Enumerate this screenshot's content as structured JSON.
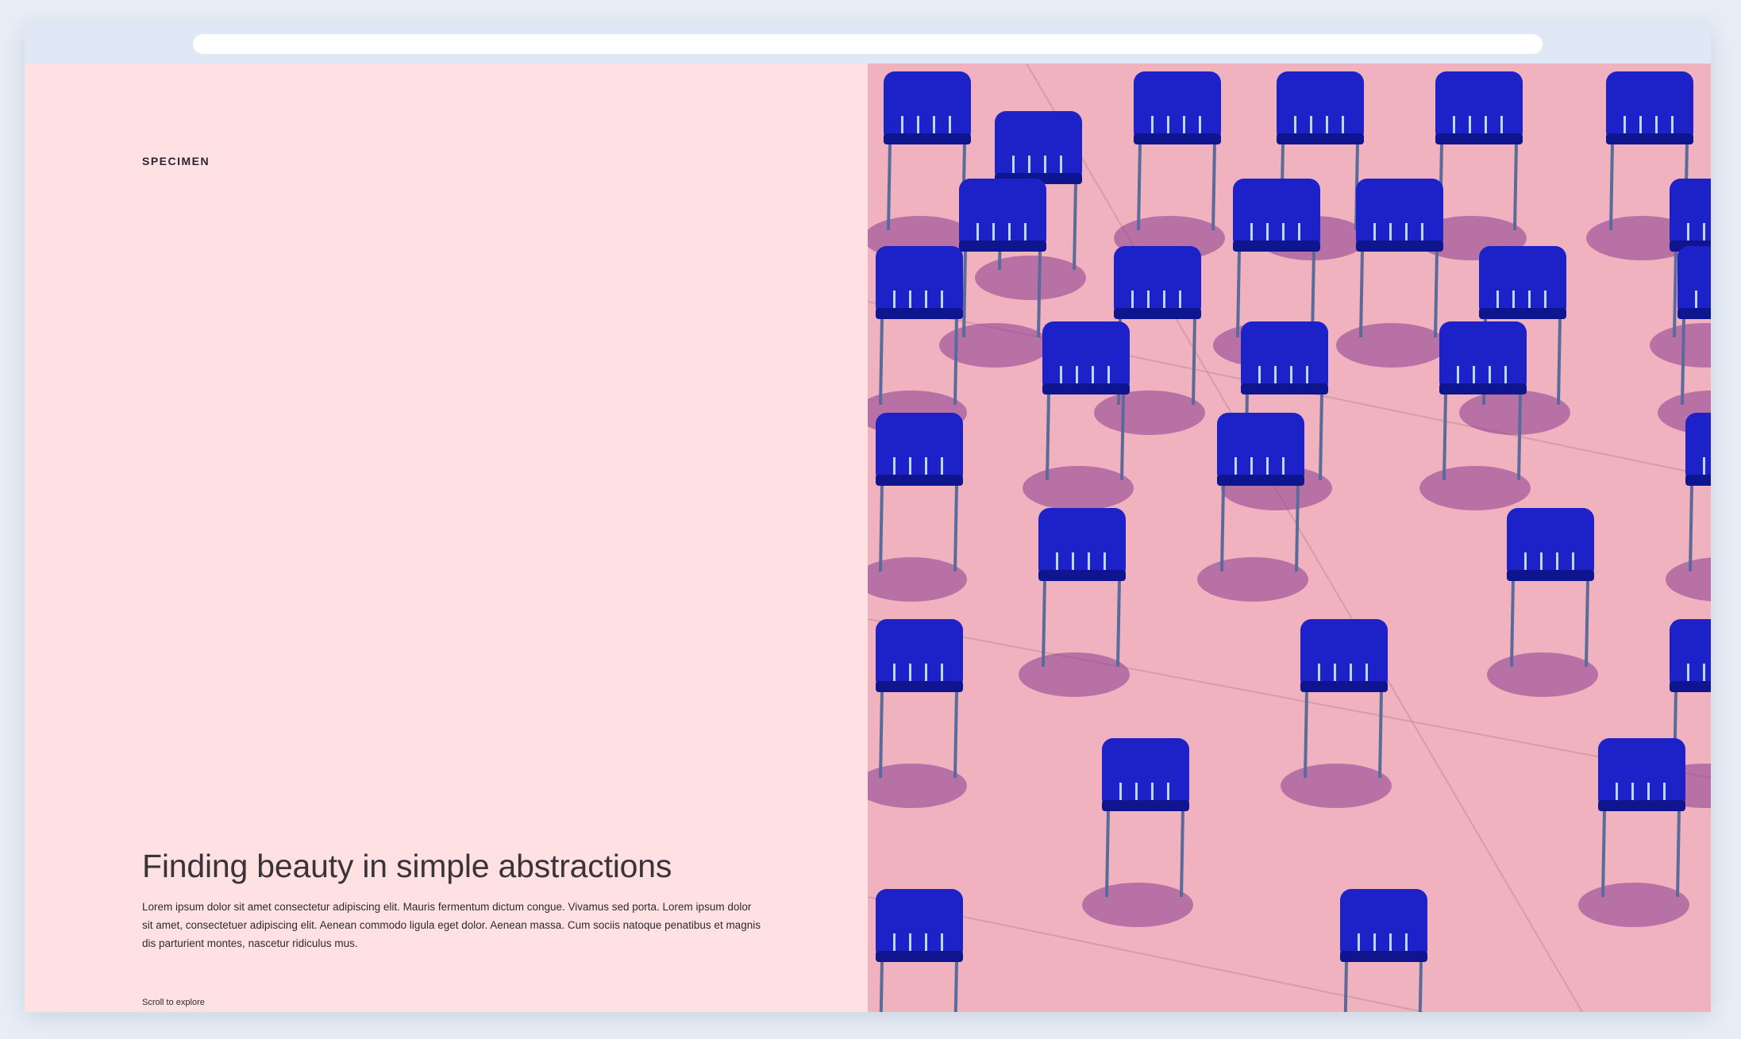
{
  "browser": {
    "address_bar_value": ""
  },
  "hero": {
    "brand": "SPECIMEN",
    "headline": "Finding beauty in simple abstractions",
    "body": "Lorem ipsum dolor sit amet consectetur adipiscing elit. Mauris fermentum dictum congue. Vivamus sed porta. Lorem ipsum dolor sit amet, consectetuer adipiscing elit. Aenean commodo ligula eget dolor. Aenean massa. Cum sociis natoque penatibus et magnis dis parturient montes, nascetur ridiculus mus.",
    "scroll_hint": "Scroll to explore"
  },
  "image": {
    "subject": "blue chairs on pink plaza",
    "colors": {
      "ground": "#f0b2bf",
      "chair": "#1c22c8",
      "chair_dark": "#0f148f",
      "shadow": "#8a3d8f"
    }
  }
}
